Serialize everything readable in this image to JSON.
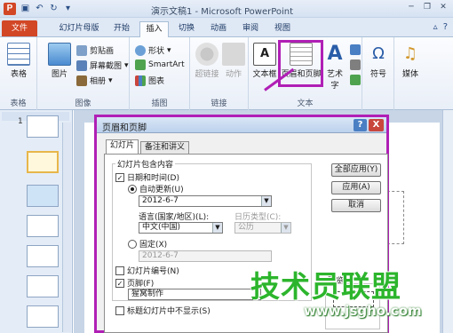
{
  "window": {
    "title": "演示文稿1 - Microsoft PowerPoint"
  },
  "ribbon_tabs": [
    {
      "label": "文件"
    },
    {
      "label": "幻灯片母版"
    },
    {
      "label": "开始"
    },
    {
      "label": "插入"
    },
    {
      "label": "切换"
    },
    {
      "label": "动画"
    },
    {
      "label": "审阅"
    },
    {
      "label": "视图"
    }
  ],
  "ribbon": {
    "groups": {
      "table": {
        "label": "表格",
        "button": "表格"
      },
      "images": {
        "label": "图像",
        "picture": "图片",
        "clipart": "剪贴画",
        "screenshot": "屏幕截图",
        "album": "相册"
      },
      "illustrations": {
        "label": "插图",
        "shapes": "形状",
        "smartart": "SmartArt",
        "chart": "图表"
      },
      "links": {
        "label": "链接",
        "hyperlink": "超链接",
        "action": "动作"
      },
      "text": {
        "label": "文本",
        "textbox": "文本框",
        "header_footer": "页眉和页脚",
        "wordart": "艺术字"
      },
      "symbols": {
        "label": "",
        "symbol": "符号"
      },
      "media": {
        "label": "",
        "media": "媒体"
      }
    }
  },
  "slide_pane": {
    "first_number": "1"
  },
  "dialog": {
    "title": "页眉和页脚",
    "help": "?",
    "close": "X",
    "tabs": [
      {
        "label": "幻灯片"
      },
      {
        "label": "备注和讲义"
      }
    ],
    "section_label": "幻灯片包含内容",
    "date_time": {
      "label": "日期和时间(D)",
      "checked": "✓"
    },
    "auto_update": {
      "label": "自动更新(U)"
    },
    "auto_date_value": "2012-6-7",
    "language": {
      "label": "语言(国家/地区)(L):",
      "value": "中文(中国)"
    },
    "calendar": {
      "label": "日历类型(C):",
      "value": "公历"
    },
    "fixed": {
      "label": "固定(X)",
      "value": "2012-6-7"
    },
    "slide_number": {
      "label": "幻灯片编号(N)"
    },
    "footer": {
      "label": "页脚(F)",
      "checked": "✓",
      "value": "猩窝制作"
    },
    "hide_on_title": {
      "label": "标题幻灯片中不显示(S)"
    },
    "buttons": {
      "apply_all": "全部应用(Y)",
      "apply": "应用(A)",
      "cancel": "取消"
    },
    "preview_label": "预览"
  },
  "watermark": {
    "text": "技术员联盟",
    "url": "www.jsgho.com"
  }
}
